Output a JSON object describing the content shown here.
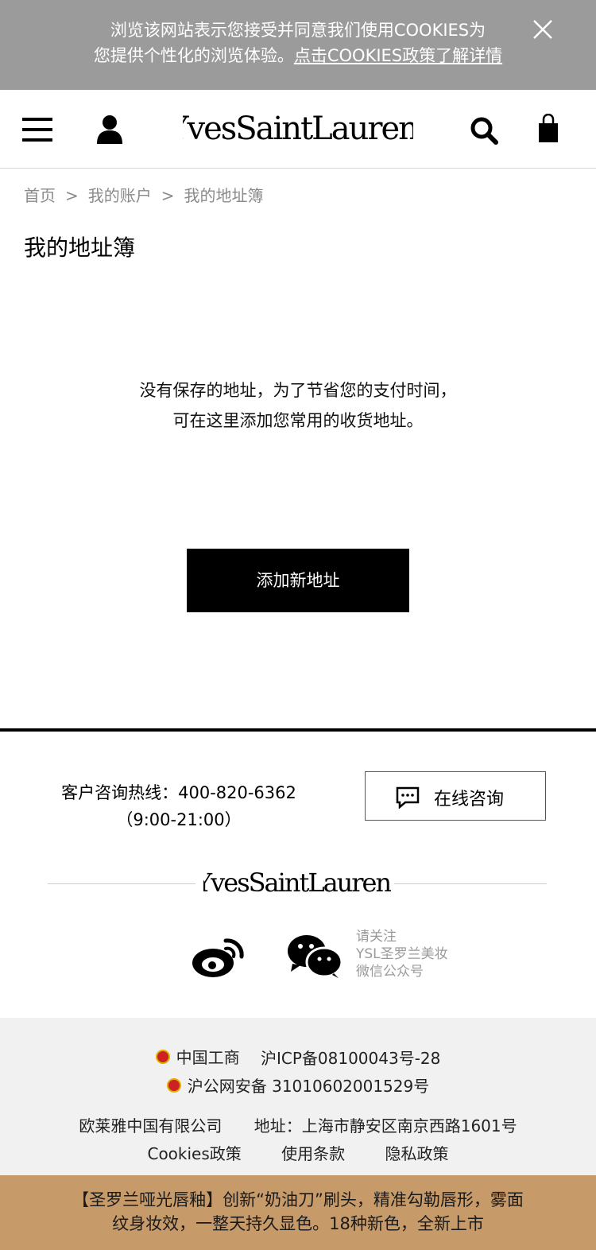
{
  "cookie_banner": {
    "text_line1": "浏览该网站表示您接受并同意我们使用COOKIES为",
    "text_line2_prefix": "您提供个性化的浏览体验。",
    "link_text": "点击COOKIES政策了解详情"
  },
  "header": {
    "brand": "YvesSaintLaurent",
    "icons": [
      "menu-icon",
      "account-icon",
      "search-icon",
      "bag-icon"
    ]
  },
  "breadcrumb": {
    "items": [
      "首页",
      "我的账户",
      "我的地址簿"
    ],
    "separator": ">"
  },
  "page": {
    "title": "我的地址簿",
    "empty_line1": "没有保存的地址，为了节省您的支付时间，",
    "empty_line2": "可在这里添加您常用的收货地址。",
    "add_button": "添加新地址"
  },
  "footer": {
    "hotline_label": "客户咨询热线：400-820-6362",
    "hotline_hours": "（9:00-21:00）",
    "chat_button": "在线咨询",
    "brand": "YvesSaintLaurent",
    "wechat_follow": [
      "请关注",
      "YSL圣罗兰美妆",
      "微信公众号"
    ],
    "icp_org": "中国工商",
    "icp": "沪ICP备08100043号-28",
    "police": "沪公网安备 31010602001529号",
    "company": "欧莱雅中国有限公司",
    "address": "地址：上海市静安区南京西路1601号",
    "links": [
      "Cookies政策",
      "使用条款",
      "隐私政策"
    ]
  },
  "promo": {
    "line1": "【圣罗兰哑光唇釉】创新“奶油刀”刷头，精准勾勒唇形，雾面",
    "line2": "纹身妆效，一整天持久显色。18种新色，全新上市"
  },
  "colors": {
    "cookie_bg": "#9b9b9b",
    "promo_bg": "#c79a6a",
    "legal_bg": "#f1f1f1",
    "button_bg": "#000000"
  }
}
